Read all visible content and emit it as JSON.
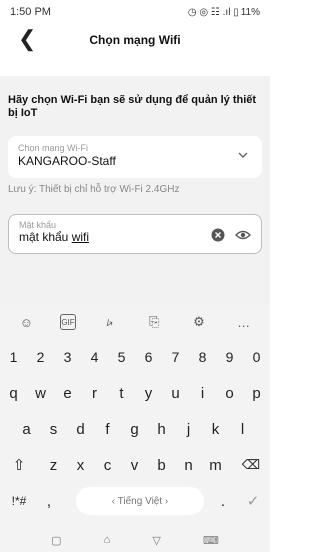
{
  "status": {
    "time": "1:50 PM",
    "icons_text": "◷ ◎ ☷ .ıl ▯",
    "battery": "11%"
  },
  "appbar": {
    "back_icon": "back-arrow-icon",
    "title": "Chọn mạng Wifi"
  },
  "prompt": "Hãy chọn Wi-Fi bạn sẽ sử dụng để quản lý thiết bị IoT",
  "wifi_field": {
    "caption": "Chọn mạng Wi-Fi",
    "value": "KANGAROO-Staff"
  },
  "note": "Lưu ý: Thiết bị chỉ hỗ trợ Wi-Fi 2.4GHz",
  "password_field": {
    "caption": "Mật khẩu",
    "value_prefix": "mật khẩu ",
    "value_suffix": "wifi"
  },
  "keyboard": {
    "toolbar": [
      "emoji-icon",
      "gif-icon",
      "sticker-icon",
      "mic-icon",
      "settings-icon",
      "more-icon"
    ],
    "toolbar_glyphs": [
      "☺",
      "GIF",
      "⭟",
      "⎘",
      "⚙",
      "…"
    ],
    "row_numbers": [
      "1",
      "2",
      "3",
      "4",
      "5",
      "6",
      "7",
      "8",
      "9",
      "0"
    ],
    "row1": [
      "q",
      "w",
      "e",
      "r",
      "t",
      "y",
      "u",
      "i",
      "o",
      "p"
    ],
    "row2": [
      "a",
      "s",
      "d",
      "f",
      "g",
      "h",
      "j",
      "k",
      "l"
    ],
    "row3": [
      "z",
      "x",
      "c",
      "v",
      "b",
      "n",
      "m"
    ],
    "shift_glyph": "⇧",
    "backspace_glyph": "⌫",
    "symbols_label": "!*#",
    "comma_label": ",",
    "space_label": "‹  Tiếng Việt  ›",
    "period_label": ".",
    "enter_glyph": "✓"
  },
  "navbar": {
    "glyphs": [
      "▢",
      "⌂",
      "▽",
      "⌨"
    ]
  },
  "colors": {
    "accent": "#f2f2f2",
    "border": "#bdbdbd"
  }
}
